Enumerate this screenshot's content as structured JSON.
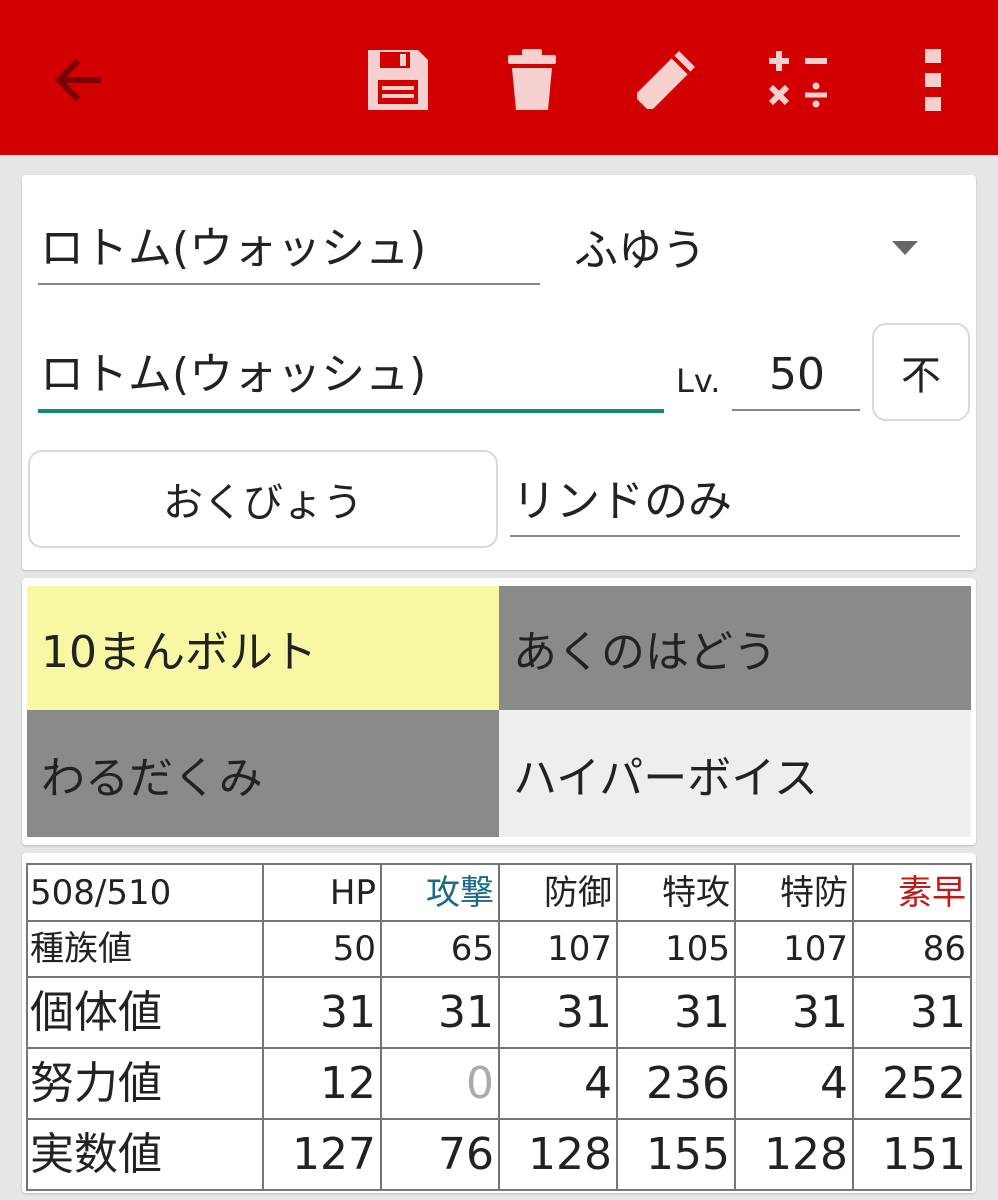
{
  "toolbar": {
    "background": "#d20000",
    "icons": [
      "arrow-left-icon",
      "save-icon",
      "trash-icon",
      "pencil-icon",
      "calculator-icon",
      "more-vertical-icon"
    ]
  },
  "pokemon": {
    "species": "ロトム(ウォッシュ)",
    "ability": "ふゆう",
    "nickname": "ロトム(ウォッシュ)",
    "level_label": "Lv.",
    "level": "50",
    "level_button": "不",
    "nature": "おくびょう",
    "item": "リンドのみ"
  },
  "moves": [
    {
      "name": "10まんボルト",
      "color": "#f8f8a4"
    },
    {
      "name": "あくのはどう",
      "color": "#8a8a8a"
    },
    {
      "name": "わるだくみ",
      "color": "#8a8a8a"
    },
    {
      "name": "ハイパーボイス",
      "color": "#eeeeee"
    }
  ],
  "stats": {
    "total": "508/510",
    "headers": [
      "HP",
      "攻撃",
      "防御",
      "特攻",
      "特防",
      "素早"
    ],
    "header_colors": [
      "#222222",
      "#1a6a86",
      "#222222",
      "#222222",
      "#222222",
      "#c21818"
    ],
    "rows": [
      {
        "label": "種族値",
        "values": [
          "50",
          "65",
          "107",
          "105",
          "107",
          "86"
        ]
      },
      {
        "label": "個体値",
        "values": [
          "31",
          "31",
          "31",
          "31",
          "31",
          "31"
        ]
      },
      {
        "label": "努力値",
        "values": [
          "12",
          "0",
          "4",
          "236",
          "4",
          "252"
        ]
      },
      {
        "label": "実数値",
        "values": [
          "127",
          "76",
          "128",
          "155",
          "128",
          "151"
        ]
      }
    ],
    "muted_color": "#aaaaaa"
  }
}
